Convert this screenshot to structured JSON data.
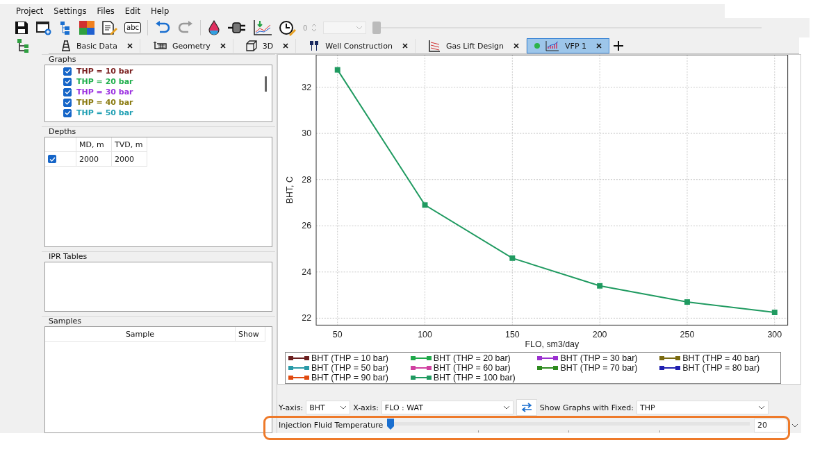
{
  "menu": [
    "Project",
    "Settings",
    "Files",
    "Edit",
    "Help"
  ],
  "toolbar": {
    "abc_label": "abc",
    "spin_value": "0"
  },
  "tabs": [
    {
      "label": "Basic Data",
      "selected": false,
      "indicator": false
    },
    {
      "label": "Geometry",
      "selected": false,
      "indicator": false
    },
    {
      "label": "3D",
      "selected": false,
      "indicator": false
    },
    {
      "label": "Well Construction",
      "selected": false,
      "indicator": false
    },
    {
      "label": "Gas Lift Design",
      "selected": false,
      "indicator": false
    },
    {
      "label": "VFP 1",
      "selected": true,
      "indicator": true
    }
  ],
  "sidebar": {
    "graphs": {
      "title": "Graphs",
      "items": [
        {
          "label": "THP = 10 bar",
          "checked": true,
          "color": "#7a1f1f"
        },
        {
          "label": "THP = 20 bar",
          "checked": true,
          "color": "#22b04e"
        },
        {
          "label": "THP = 30 bar",
          "checked": true,
          "color": "#9b30e0"
        },
        {
          "label": "THP = 40 bar",
          "checked": true,
          "color": "#8a7a10"
        },
        {
          "label": "THP = 50 bar",
          "checked": true,
          "color": "#22a0b4"
        }
      ]
    },
    "depths": {
      "title": "Depths",
      "columns": [
        "MD, m",
        "TVD, m"
      ],
      "rows": [
        {
          "checked": true,
          "cells": [
            "2000",
            "2000"
          ]
        }
      ]
    },
    "ipr": {
      "title": "IPR Tables"
    },
    "samples": {
      "title": "Samples",
      "columns": [
        "Sample",
        "Show"
      ]
    }
  },
  "chart": {
    "chart_data": {
      "type": "line",
      "grid": true,
      "marker": "square",
      "xlabel": "FLO, sm3/day",
      "ylabel": "BHT, C",
      "x": [
        50,
        100,
        150,
        200,
        250,
        300
      ],
      "xlim": [
        37.8,
        307.5
      ],
      "ylim": [
        21.7,
        33.4
      ],
      "xticks": [
        50,
        100,
        150,
        200,
        250,
        300
      ],
      "yticks": [
        22,
        24,
        26,
        28,
        30,
        32
      ],
      "series": [
        {
          "name": "BHT (THP = 10 bar)",
          "color": "#6b1f1f",
          "values": [
            null,
            null,
            null,
            null,
            null,
            null
          ]
        },
        {
          "name": "BHT (THP = 20 bar)",
          "color": "#1fa84a",
          "values": [
            null,
            null,
            null,
            null,
            null,
            null
          ]
        },
        {
          "name": "BHT (THP = 30 bar)",
          "color": "#9b30d0",
          "values": [
            null,
            null,
            null,
            null,
            null,
            null
          ]
        },
        {
          "name": "BHT (THP = 40 bar)",
          "color": "#7a6a10",
          "values": [
            null,
            null,
            null,
            null,
            null,
            null
          ]
        },
        {
          "name": "BHT (THP = 50 bar)",
          "color": "#2a9aa8",
          "values": [
            null,
            null,
            null,
            null,
            null,
            null
          ]
        },
        {
          "name": "BHT (THP = 60 bar)",
          "color": "#d040a0",
          "values": [
            null,
            null,
            null,
            null,
            null,
            null
          ]
        },
        {
          "name": "BHT (THP = 70 bar)",
          "color": "#2e8a1e",
          "values": [
            null,
            null,
            null,
            null,
            null,
            null
          ]
        },
        {
          "name": "BHT (THP = 80 bar)",
          "color": "#2020b0",
          "values": [
            null,
            null,
            null,
            null,
            null,
            null
          ]
        },
        {
          "name": "BHT (THP = 90 bar)",
          "color": "#e04a10",
          "values": [
            null,
            null,
            null,
            null,
            null,
            null
          ]
        },
        {
          "name": "BHT (THP = 100 bar)",
          "color": "#1f9a60",
          "values": [
            32.75,
            26.9,
            24.6,
            23.4,
            22.7,
            22.25
          ]
        }
      ]
    }
  },
  "controls": {
    "y_axis_label": "Y-axis:",
    "y_axis_value": "BHT",
    "x_axis_label": "X-axis:",
    "x_axis_value": "FLO : WAT",
    "fixed_label": "Show Graphs with Fixed:",
    "fixed_value": "THP"
  },
  "slider": {
    "label": "Injection Fluid Temperature",
    "level": 0,
    "value": "20",
    "highlighted": true
  }
}
